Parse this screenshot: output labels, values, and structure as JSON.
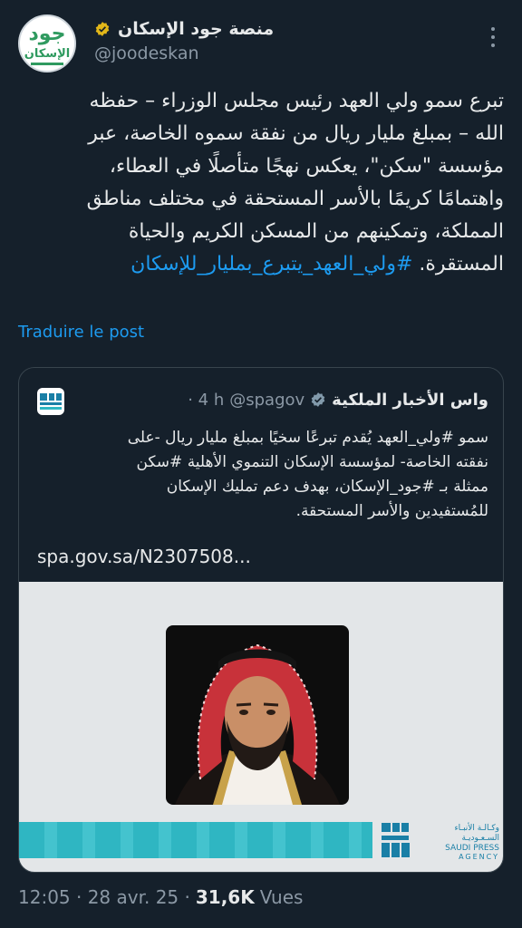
{
  "author": {
    "name": "منصة جود الإسكان",
    "handle": "@joodeskan",
    "avatar_word_top": "جود",
    "avatar_word_bottom": "الإسكان",
    "avatar_color": "#2f9a5f"
  },
  "tweet": {
    "lines": [
      "تبرع سمو ولي العهد رئيس مجلس الوزراء – حفظه",
      "الله – بمبلغ مليار ريال من نفقة سموه الخاصة، عبر",
      "مؤسسة \"سكن\"، يعكس نهجًا متأصلًا في العطاء،",
      "واهتمامًا كريمًا بالأسر المستحقة في مختلف مناطق",
      "المملكة، وتمكينهم من المسكن الكريم والحياة"
    ],
    "last_line_text": "المستقرة.",
    "hashtag": "#ولي_العهد_يتبرع_بمليار_للإسكان"
  },
  "translate_label": "Traduire le post",
  "quote": {
    "name": "واس الأخبار الملكية",
    "handle": "@spagov",
    "time": "· 4 h",
    "lines": [
      "سمو #ولي_العهد يُقدم تبرعًا سخيًا بمبلغ مليار ريال -على",
      "نفقته الخاصة- لمؤسسة الإسكان التنموي الأهلية #سكن",
      "ممثلة بـ #جود_الإسكان، بهدف دعم تمليك الإسكان",
      "للمُستفيدين والأسر المستحقة."
    ],
    "url": "spa.gov.sa/N2307508...",
    "logo_arabic_top": "وكـالـة الأنبـاء",
    "logo_arabic_bottom": "السـعـوديـة",
    "logo_english_1": "SAUDI PRESS",
    "logo_english_2": "AGENCY",
    "band_color": "#2fb6c2",
    "logo_color": "#1a7fa6"
  },
  "footer": {
    "time": "12:05 · 28 avr. 25 ·",
    "views": "31,6K",
    "views_label": "Vues"
  },
  "colors": {
    "background": "#15202b",
    "accent": "#1d9bf0",
    "verified": "#e2b719"
  },
  "icons": [
    "verified-badge-icon",
    "more-options-icon",
    "spa-logo-icon"
  ]
}
